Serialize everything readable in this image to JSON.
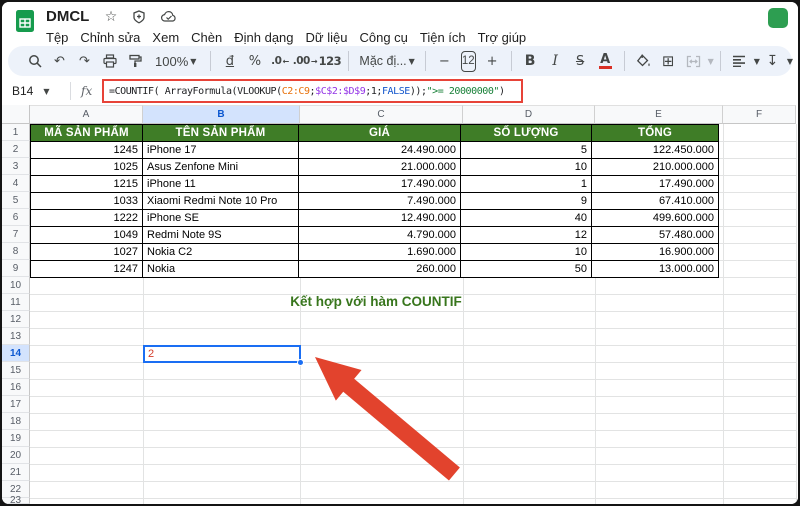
{
  "titlebar": {
    "doc_title": "DMCL",
    "icons": {
      "star": "☆",
      "cloud": "☁"
    }
  },
  "menubar": {
    "items": [
      "Tệp",
      "Chỉnh sửa",
      "Xem",
      "Chèn",
      "Định dạng",
      "Dữ liệu",
      "Công cụ",
      "Tiện ích",
      "Trợ giúp"
    ]
  },
  "toolbar": {
    "zoom_value": "100%",
    "currency_label": "đ",
    "percent_label": "%",
    "decrease_decimals_label": ".0",
    "increase_decimals_label": ".00",
    "more_formats_label": "123",
    "font_name": "Mặc đị...",
    "minus_label": "−",
    "font_size": "12",
    "plus_label": "+",
    "bold_label": "B",
    "italic_label": "I",
    "strikethrough_label": "S",
    "text_color_label": "A",
    "icons": {
      "undo": "↶",
      "redo": "↷",
      "borders": "⊞",
      "vertical_align": "↧",
      "text_wrap": "⇥",
      "caret": "▼"
    }
  },
  "formula_bar": {
    "cell_ref": "B14",
    "fx_label": "fx",
    "segments": [
      {
        "text": "=COUNTIF( ArrayFormula(VLOOKUP(",
        "color": "#202124"
      },
      {
        "text": "C2:C9",
        "color": "#e8710a"
      },
      {
        "text": ";",
        "color": "#202124"
      },
      {
        "text": "$C$2:$D$9",
        "color": "#9334e6"
      },
      {
        "text": ";1;",
        "color": "#202124"
      },
      {
        "text": "FALSE",
        "color": "#1155cc"
      },
      {
        "text": "));",
        "color": "#202124"
      },
      {
        "text": "\">= 20000000\"",
        "color": "#188038"
      },
      {
        "text": ")",
        "color": "#202124"
      }
    ]
  },
  "grid": {
    "column_letters": [
      "A",
      "B",
      "C",
      "D",
      "E",
      "F"
    ],
    "visible_rows": 23,
    "selected_column": "B",
    "selected_row": 14,
    "selected_cell": "B14"
  },
  "table": {
    "headers": [
      "MÃ SẢN PHẨM",
      "TÊN SẢN PHẨM",
      "GIÁ",
      "SỐ LƯỢNG",
      "TỔNG"
    ],
    "rows": [
      [
        "1245",
        "iPhone 17",
        "24.490.000",
        "5",
        "122.450.000"
      ],
      [
        "1025",
        "Asus Zenfone Mini",
        "21.000.000",
        "10",
        "210.000.000"
      ],
      [
        "1215",
        "iPhone 11",
        "17.490.000",
        "1",
        "17.490.000"
      ],
      [
        "1033",
        "Xiaomi Redmi Note 10 Pro",
        "7.490.000",
        "9",
        "67.410.000"
      ],
      [
        "1222",
        "iPhone SE",
        "12.490.000",
        "40",
        "499.600.000"
      ],
      [
        "1049",
        "Redmi Note 9S",
        "4.790.000",
        "12",
        "57.480.000"
      ],
      [
        "1027",
        "Nokia C2",
        "1.690.000",
        "10",
        "16.900.000"
      ],
      [
        "1247",
        "Nokia",
        "260.000",
        "50",
        "13.000.000"
      ]
    ]
  },
  "sheet_content": {
    "note_title": "Kết hợp với hàm COUNTIF",
    "result_cell_value": "2"
  },
  "colors": {
    "table_header_bg": "#3f7d27",
    "note_title_color": "#38761d",
    "result_value_color": "#d43b2a",
    "arrow_color": "#e2432d",
    "formula_box_border": "#e74338",
    "selection_border": "#1a6ef3",
    "selected_header_bg": "#d3e3fd",
    "toolbar_bg": "#edf2fa"
  }
}
